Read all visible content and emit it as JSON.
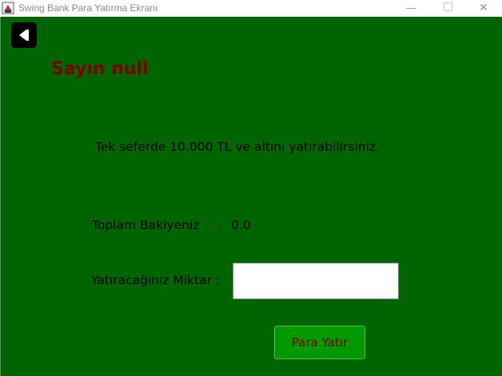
{
  "window": {
    "title": "Swing Bank Para Yatırma Ekranı",
    "minimize_glyph": "—",
    "close_glyph": "✕"
  },
  "colors": {
    "background": "#006400",
    "greeting": "#7a0000",
    "button_bg": "#009a00",
    "button_text": "#7a0000"
  },
  "icons": {
    "app": "java-app-icon",
    "back": "back-arrow-icon"
  },
  "greeting": "Sayın null",
  "info": "Tek seferde 10.000 TL ve altını yatırabilirsiniz.",
  "balance": {
    "label": "Toplam Bakiyeniz",
    "colon": ":",
    "value": "0.0"
  },
  "amount": {
    "label": "Yatıracağınız Miktar :",
    "value": ""
  },
  "deposit_button": "Para Yatır"
}
